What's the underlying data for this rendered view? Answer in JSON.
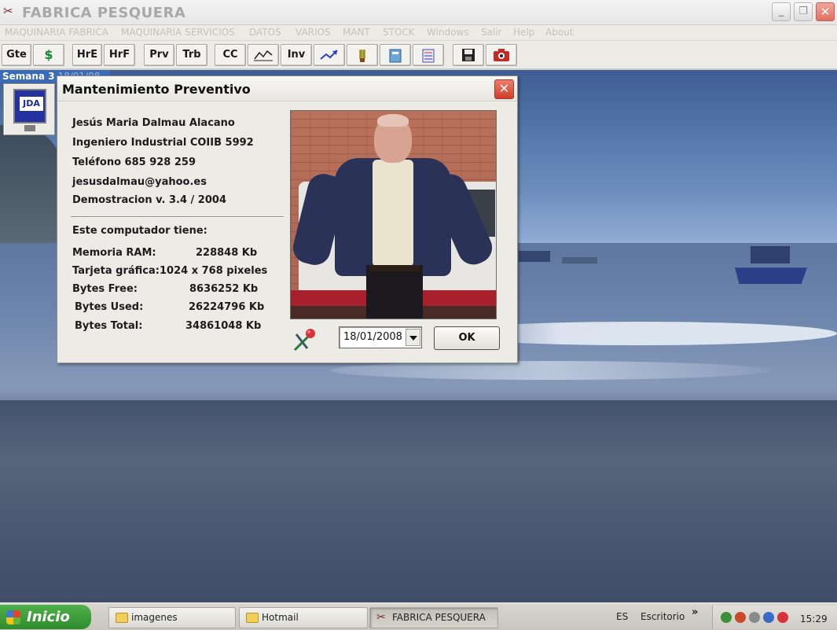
{
  "window": {
    "title": "FABRICA PESQUERA",
    "controls": {
      "minimize": "_",
      "maximize": "❐",
      "close": "✕"
    }
  },
  "menu": [
    "MAQUINARIA FABRICA",
    "MAQUINARIA SERVICIOS",
    "DATOS",
    "VARIOS",
    "MANT",
    "STOCK",
    "Windows",
    "Salir",
    "Help",
    "About"
  ],
  "toolbar": {
    "buttons": [
      {
        "label": "Gte"
      },
      {
        "label": "$"
      },
      {
        "label": "HrE"
      },
      {
        "label": "HrF"
      },
      {
        "label": "Prv"
      },
      {
        "label": "Trb"
      },
      {
        "label": "CC"
      },
      {
        "icon": "graph-icon"
      },
      {
        "label": "Inv"
      },
      {
        "icon": "chart-arrow-icon"
      },
      {
        "icon": "brush-icon"
      },
      {
        "icon": "book-icon"
      },
      {
        "icon": "calculator-icon"
      },
      {
        "icon": "save-icon"
      },
      {
        "icon": "camera-icon"
      }
    ]
  },
  "sidebar": {
    "week_label": "Semana 3",
    "week_date_faded": "18/01/08",
    "jda_label": "JDA"
  },
  "dialog": {
    "title": "Mantenimiento Preventivo",
    "close": "✕",
    "author": {
      "name": "Jesús Maria Dalmau Alacano",
      "title": "Ingeniero Industrial COIIB 5992",
      "phone": "Teléfono 685 928 259",
      "email": "jesusdalmau@yahoo.es",
      "version": "Demostracion v. 3.4 / 2004"
    },
    "system_heading": "Este computador tiene:",
    "stats": {
      "ram": {
        "label": "Memoria RAM:",
        "value": "228848 Kb"
      },
      "graphics": {
        "label": "Tarjeta gráfica:",
        "value": "1024 x 768 pixeles"
      },
      "free": {
        "label": "Bytes Free:",
        "value": "8636252 Kb"
      },
      "used": {
        "label": "Bytes Used:",
        "value": "26224796 Kb"
      },
      "total": {
        "label": "Bytes Total:",
        "value": "34861048 Kb"
      }
    },
    "date_value": "18/01/2008",
    "ok_label": "OK"
  },
  "taskbar": {
    "start_label": "Inicio",
    "tasks": [
      {
        "label": "imagenes",
        "active": false
      },
      {
        "label": "Hotmail",
        "active": false
      },
      {
        "label": "FABRICA PESQUERA",
        "active": true
      }
    ],
    "language": "ES",
    "desktop_label": "Escritorio",
    "chevron": "»",
    "clock": "15:29"
  },
  "colors": {
    "close_red": "#d8462f",
    "start_green": "#3c9d38",
    "week_bar_blue": "#3b6bb6",
    "dollar_green": "#138a2c"
  }
}
